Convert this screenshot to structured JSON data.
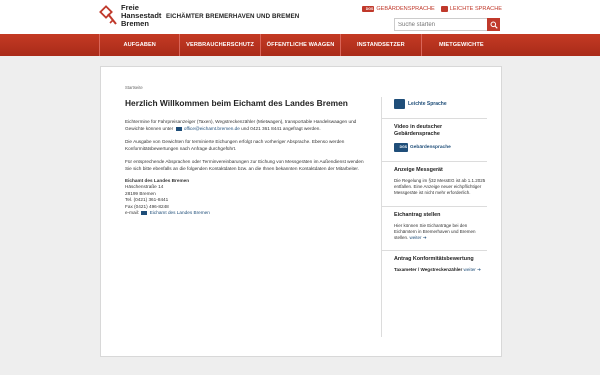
{
  "header": {
    "logo_lines": [
      "Freie",
      "Hansestadt",
      "Bremen"
    ],
    "agency_name": "EICHÄMTER BREMERHAVEN UND BREMEN",
    "sign_language_label": "GEBÄRDENSPRACHE",
    "easy_language_label": "LEICHTE SPRACHE",
    "search_placeholder": "Suche starten",
    "accent_color": "#c0392b"
  },
  "nav": {
    "items": [
      {
        "label": "AUFGABEN"
      },
      {
        "label": "VERBRAUCHERSCHUTZ"
      },
      {
        "label": "ÖFFENTLICHE WAAGEN"
      },
      {
        "label": "INSTANDSETZER"
      },
      {
        "label": "MIETGEWICHTE"
      }
    ]
  },
  "content": {
    "breadcrumb": "Startseite",
    "title": "Herzlich Willkommen beim Eichamt des Landes Bremen",
    "p1_before": "Eichtermine für Fahrpreisanzeiger (Taxen), Wegstreckenzähler (Mietwagen), transportable Handelswaagen und Gewichte können unter",
    "p1_email": "office@eichamt.bremen.de",
    "p1_after": "und 0421 361 8441 angefragt werden.",
    "p2": "Die Ausgabe von Gewichten für terminierte Eichungen erfolgt nach vorheriger Absprache. Ebenso werden Konformitätsbewertungen nach Anfrage durchgeführt.",
    "p3": "Für entsprechende Absprachen oder Terminvereinbarungen zur Eichung von Messgeräten im Außendienst wenden Sie sich bitte ebenfalls an die folgenden Kontaktdaten bzw. an die Ihnen bekannten Kontaktdaten der Mitarbeiter.",
    "address": {
      "name": "Eichamt des Landes Bremen",
      "street": "Häschenstraße 14",
      "city": "28199 Bremen",
      "tel": "Tel. (0421) 361-8441",
      "fax": "Fax (0421) 496-8248",
      "email_label": "e-mail:",
      "email_link": "Eichamt des Landes Bremen"
    }
  },
  "sidebar": {
    "easy_language": "Leichte Sprache",
    "video_heading": "Video in deutscher Gebärdensprache",
    "dgs_label": "Gebärdensprache",
    "messgeraet_heading": "Anzeige Messgerät",
    "messgeraet_text": "Die Regelung im §32 MessEG ist ab 1.1.2025 entfallen. Eine Anzeige neuer eichpflichtiger Messgeräte ist nicht mehr erforderlich.",
    "eichantrag_heading": "Eichantrag stellen",
    "eichantrag_text": "Hier können Sie Eichanträge bei den Eichämtern in Bremerhaven und Bremen stellen.",
    "weiter": "weiter",
    "konform_heading": "Antrag Konformitätsbewertung",
    "konform_text": "Taxameter / Wegstreckenzähler"
  }
}
